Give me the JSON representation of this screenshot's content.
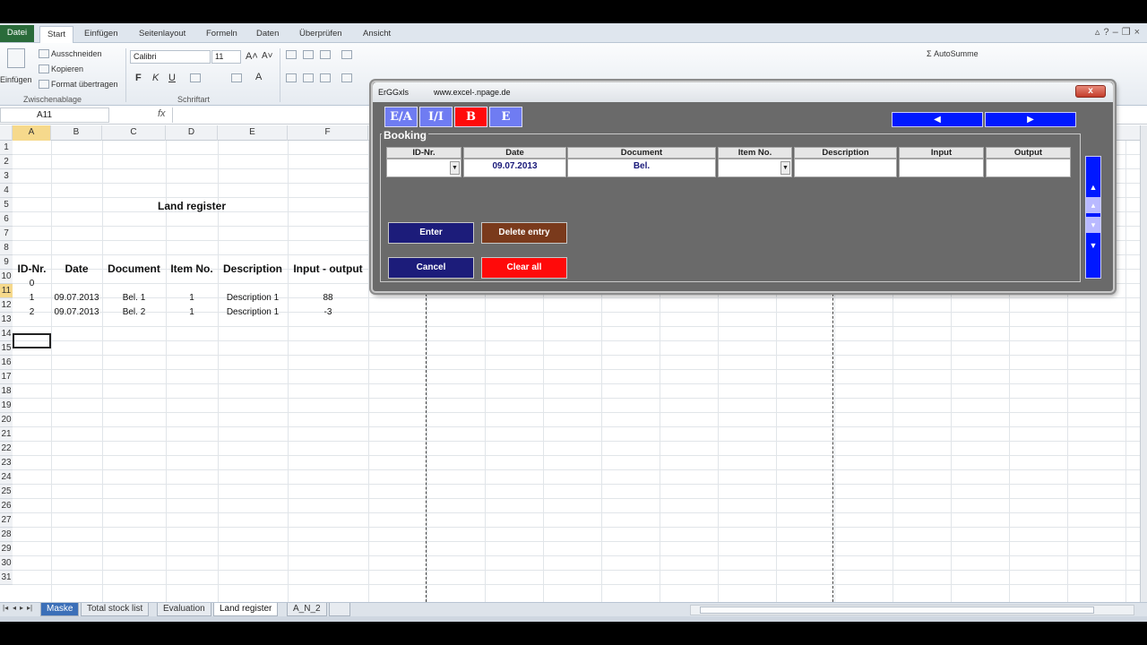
{
  "ribbon": {
    "file_tab": "Datei",
    "tabs": [
      "Start",
      "Einfügen",
      "Seitenlayout",
      "Formeln",
      "Daten",
      "Überprüfen",
      "Ansicht"
    ],
    "active_tab": "Start",
    "clipboard": {
      "paste": "Einfügen",
      "cut": "Ausschneiden",
      "copy": "Kopieren",
      "format_painter": "Format übertragen",
      "group": "Zwischenablage"
    },
    "font": {
      "name": "Calibri",
      "size": "11",
      "group": "Schriftart",
      "bold": "F",
      "italic": "K",
      "underline": "U"
    },
    "autosum": "Σ AutoSumme"
  },
  "formula_bar": {
    "name_box": "A11",
    "fx": "fx"
  },
  "columns": [
    "A",
    "B",
    "C",
    "D",
    "E",
    "F"
  ],
  "rows": [
    "1",
    "2",
    "3",
    "4",
    "5",
    "6",
    "7",
    "8",
    "9",
    "10",
    "11",
    "12",
    "13",
    "14",
    "15",
    "16",
    "17",
    "18",
    "19",
    "20",
    "21",
    "22",
    "23",
    "24",
    "25",
    "26",
    "27",
    "28",
    "29",
    "30",
    "31"
  ],
  "sheet": {
    "title": "Land register",
    "headers": [
      "ID-Nr.",
      "Date",
      "Document",
      "Item No.",
      "Description",
      "Input - output"
    ],
    "row8_id": "0",
    "data": [
      {
        "id": "1",
        "date": "09.07.2013",
        "doc": "Bel. 1",
        "item": "1",
        "desc": "Description 1",
        "io": "88"
      },
      {
        "id": "2",
        "date": "09.07.2013",
        "doc": "Bel. 2",
        "item": "1",
        "desc": "Description 1",
        "io": "-3"
      }
    ]
  },
  "sheet_tabs": [
    "Maske",
    "Total stock list",
    "Evaluation",
    "Land register",
    "A_N_2"
  ],
  "active_sheet": "Land register",
  "dialog": {
    "name": "ErGGxls",
    "url": "www.excel-.npage.de",
    "close": "x",
    "mode_buttons": [
      {
        "label": "E/A",
        "color": "#6f7cf2"
      },
      {
        "label": "I/I",
        "color": "#6f7cf2"
      },
      {
        "label": "B",
        "color": "#ff0a0a"
      },
      {
        "label": "E",
        "color": "#6f7cf2"
      }
    ],
    "nav_prev": "◀",
    "nav_next": "▶",
    "frame_title": "Booking",
    "fields": [
      "ID-Nr.",
      "Date",
      "Document",
      "Item No.",
      "Description",
      "Input",
      "Output"
    ],
    "values": {
      "id": "",
      "date": "09.07.2013",
      "document": "Bel.",
      "item": "",
      "description": "",
      "input": "",
      "output": ""
    },
    "buttons": {
      "enter": "Enter",
      "delete": "Delete entry",
      "cancel": "Cancel",
      "clear": "Clear all"
    },
    "colors": {
      "enter": "#1c1c7a",
      "delete": "#7a3a1c",
      "cancel": "#1c1c7a",
      "clear": "#ff0a0a",
      "nav": "#0018ff"
    }
  }
}
